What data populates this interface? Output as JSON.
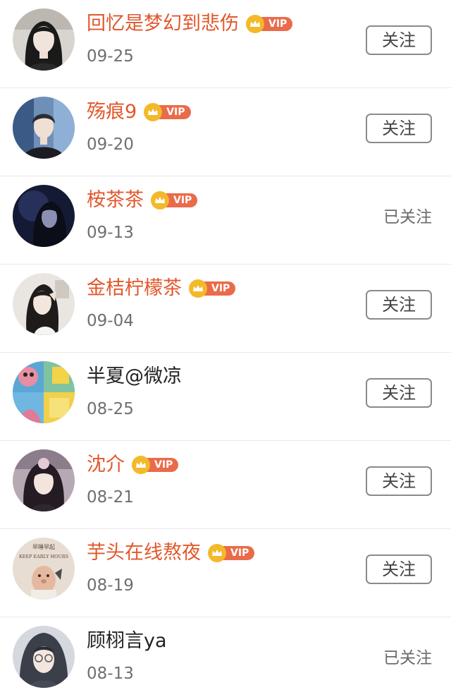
{
  "vip_label": "VIP",
  "colors": {
    "vip_name": "#e2572b",
    "normal_name": "#222222",
    "vip_badge": "#ea6b4a",
    "crown": "#f3b92a"
  },
  "users": [
    {
      "name": "回忆是梦幻到悲伤",
      "vip": true,
      "date": "09-25",
      "action": "关注",
      "followed": false
    },
    {
      "name": "殇痕9",
      "vip": true,
      "date": "09-20",
      "action": "关注",
      "followed": false
    },
    {
      "name": "桉茶茶",
      "vip": true,
      "date": "09-13",
      "action": "已关注",
      "followed": true
    },
    {
      "name": "金桔柠檬茶",
      "vip": true,
      "date": "09-04",
      "action": "关注",
      "followed": false
    },
    {
      "name": "半夏@微凉",
      "vip": false,
      "date": "08-25",
      "action": "关注",
      "followed": false
    },
    {
      "name": "沈介",
      "vip": true,
      "date": "08-21",
      "action": "关注",
      "followed": false
    },
    {
      "name": "芋头在线熬夜",
      "vip": true,
      "date": "08-19",
      "action": "关注",
      "followed": false
    },
    {
      "name": "顾栩言ya",
      "vip": false,
      "date": "08-13",
      "action": "已关注",
      "followed": true
    }
  ],
  "avatar_texts": {
    "row7_sign_top": "早睡早起",
    "row7_sign_bottom": "KEEP EARLY HOURS"
  }
}
